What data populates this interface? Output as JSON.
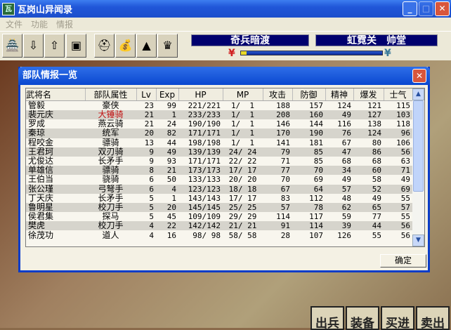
{
  "window": {
    "title": "瓦岗山异闻录",
    "icon_label": "瓦"
  },
  "menu": [
    "文件",
    "功能",
    "情报"
  ],
  "toolbar": {
    "icons": [
      "castle-icon",
      "scroll-down-icon",
      "scroll-up-icon",
      "computer-icon",
      "helmet-icon",
      "money-bag-icon",
      "mountain-icon",
      "gold-ingot-icon"
    ],
    "banner_left": "奇兵暗渡",
    "banner_right": "虹霓关　帅堂",
    "progress": 0.04
  },
  "dialog": {
    "title": "部队情报一览",
    "ok": "确定",
    "headers": [
      "武将名",
      "部队属性",
      "Lv",
      "Exp",
      "HP",
      "MP",
      "攻击",
      "防御",
      "精神",
      "爆发",
      "士气"
    ],
    "rows": [
      [
        "管毅",
        "豪侠",
        "23",
        "99",
        "221/221",
        "1/  1",
        "188",
        "157",
        "124",
        "121",
        "115"
      ],
      [
        "裴元庆",
        "大锤骑",
        "21",
        "1",
        "233/233",
        "1/  1",
        "208",
        "160",
        "49",
        "127",
        "103"
      ],
      [
        "罗成",
        "燕云骑",
        "21",
        "24",
        "190/190",
        "1/  1",
        "146",
        "144",
        "116",
        "138",
        "118"
      ],
      [
        "秦琼",
        "统军",
        "20",
        "82",
        "171/171",
        "1/  1",
        "170",
        "190",
        "76",
        "124",
        "96"
      ],
      [
        "程咬金",
        "骠骑",
        "13",
        "44",
        "198/198",
        "1/  1",
        "141",
        "181",
        "67",
        "80",
        "106"
      ],
      [
        "王君珂",
        "双刃骑",
        "9",
        "49",
        "139/139",
        "24/ 24",
        "79",
        "85",
        "47",
        "86",
        "56"
      ],
      [
        "尤俊达",
        "长矛手",
        "9",
        "93",
        "171/171",
        "22/ 22",
        "71",
        "85",
        "68",
        "68",
        "63"
      ],
      [
        "单雄信",
        "骠骑",
        "8",
        "21",
        "173/173",
        "17/ 17",
        "77",
        "70",
        "34",
        "60",
        "71"
      ],
      [
        "王伯当",
        "骁骑",
        "6",
        "50",
        "133/133",
        "20/ 20",
        "70",
        "69",
        "49",
        "58",
        "49"
      ],
      [
        "张公瑾",
        "弓弩手",
        "6",
        "4",
        "123/123",
        "18/ 18",
        "67",
        "64",
        "57",
        "52",
        "69"
      ],
      [
        "丁天庆",
        "长矛手",
        "5",
        "1",
        "143/143",
        "17/ 17",
        "83",
        "112",
        "48",
        "49",
        "55"
      ],
      [
        "鲁明星",
        "校刀手",
        "5",
        "20",
        "145/145",
        "25/ 25",
        "57",
        "78",
        "62",
        "65",
        "57"
      ],
      [
        "侯君集",
        "探马",
        "5",
        "45",
        "109/109",
        "29/ 29",
        "114",
        "117",
        "59",
        "77",
        "55"
      ],
      [
        "樊虎",
        "校刀手",
        "4",
        "22",
        "142/142",
        "21/ 21",
        "91",
        "114",
        "39",
        "44",
        "56"
      ],
      [
        "徐茂功",
        "道人",
        "4",
        "16",
        " 98/ 98",
        "58/ 58",
        "28",
        "107",
        "126",
        "55",
        "56"
      ]
    ]
  },
  "bottom_buttons": [
    "出兵",
    "装备",
    "买进",
    "卖出"
  ],
  "colors": {
    "highlight_unit": "#c01010",
    "title_blue": "#0a48d0"
  }
}
